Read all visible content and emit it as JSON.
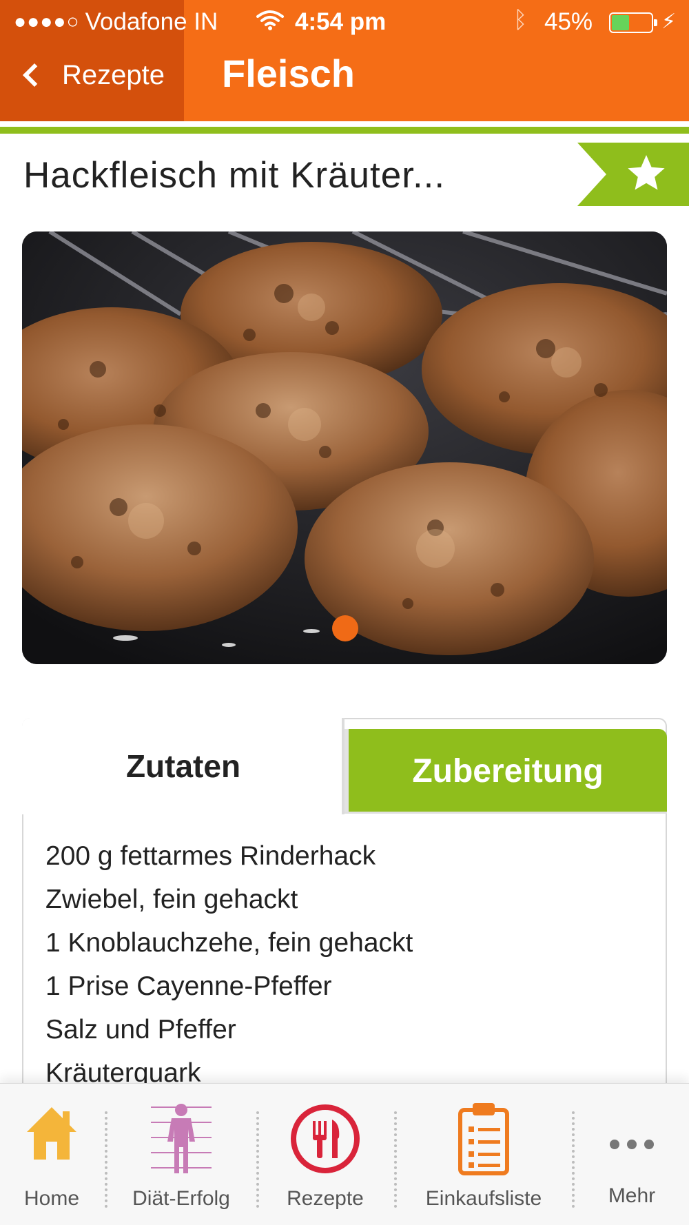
{
  "status_bar": {
    "signal_dots": "●●●●○",
    "carrier": "Vodafone IN",
    "time": "4:54 pm",
    "battery_percent": "45%",
    "battery_level": 0.45
  },
  "nav": {
    "back_label": "Rezepte",
    "title": "Fleisch"
  },
  "recipe": {
    "title": "Hackfleisch mit Kräuter...",
    "favorite_icon": "star-icon"
  },
  "photo": {
    "page_indicator": {
      "current": 1,
      "total": 1
    }
  },
  "tabs": {
    "active": "Zutaten",
    "inactive": "Zubereitung"
  },
  "ingredients": [
    "200 g fettarmes Rinderhack",
    "Zwiebel, fein gehackt",
    "1 Knoblauchzehe, fein gehackt",
    "1 Prise Cayenne-Pfeffer",
    "Salz und Pfeffer",
    "Kräuterquark"
  ],
  "tabbar": [
    {
      "label": "Home",
      "icon": "home-icon"
    },
    {
      "label": "Diät-Erfolg",
      "icon": "body-icon"
    },
    {
      "label": "Rezepte",
      "icon": "fork-knife-icon"
    },
    {
      "label": "Einkaufsliste",
      "icon": "clipboard-list-icon"
    },
    {
      "label": "Mehr",
      "icon": "more-dots-icon"
    }
  ],
  "colors": {
    "header_orange": "#f56d16",
    "back_zone": "#d4500c",
    "accent_green": "#8fbe1c",
    "page_dot": "#f06a16",
    "recipes_red": "#d9243a",
    "home_yellow": "#f4b53a",
    "diet_pink": "#c77bb6",
    "list_orange": "#ef7b1f"
  }
}
